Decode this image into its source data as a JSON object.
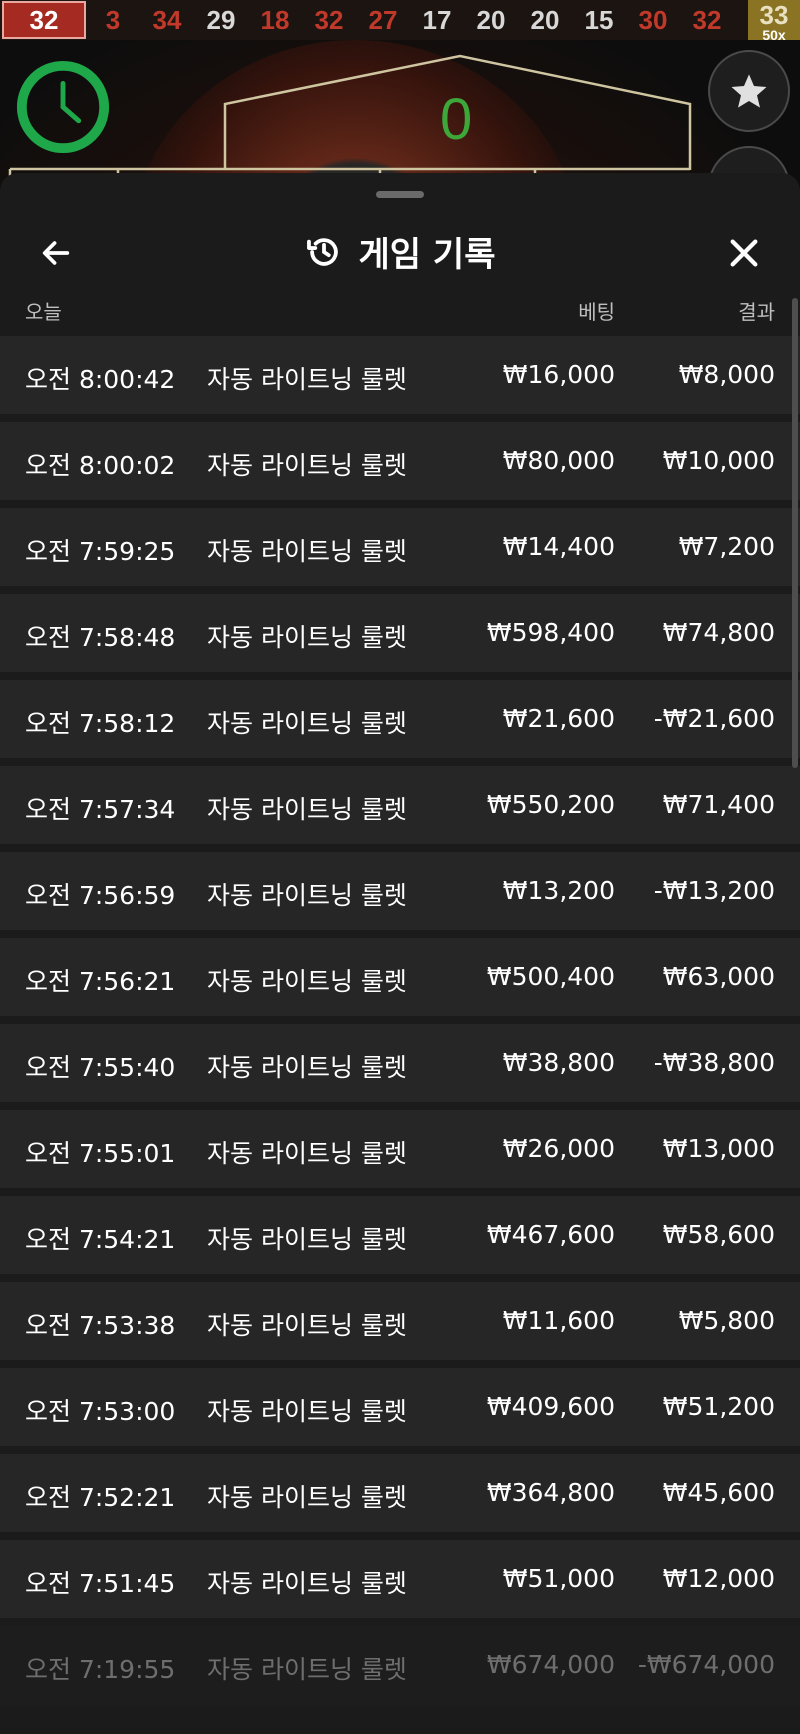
{
  "results_strip": {
    "first": "32",
    "numbers": [
      {
        "value": "3",
        "color": "red"
      },
      {
        "value": "34",
        "color": "red"
      },
      {
        "value": "29",
        "color": "black"
      },
      {
        "value": "18",
        "color": "red"
      },
      {
        "value": "32",
        "color": "red"
      },
      {
        "value": "27",
        "color": "red"
      },
      {
        "value": "17",
        "color": "black"
      },
      {
        "value": "20",
        "color": "black"
      },
      {
        "value": "20",
        "color": "black"
      },
      {
        "value": "15",
        "color": "black"
      },
      {
        "value": "30",
        "color": "red"
      },
      {
        "value": "32",
        "color": "red"
      }
    ],
    "last": "33",
    "last_multiplier": "50x"
  },
  "game": {
    "zero_label": "0"
  },
  "header": {
    "title": "게임 기록",
    "back_icon": "arrow-left-icon",
    "history_icon": "history-icon",
    "close_icon": "close-icon"
  },
  "columns": {
    "date": "오늘",
    "bet": "베팅",
    "result": "결과"
  },
  "rows": [
    {
      "time": "오전 8:00:42",
      "game": "자동 라이트닝 룰렛",
      "bet": "₩16,000",
      "result": "₩8,000"
    },
    {
      "time": "오전 8:00:02",
      "game": "자동 라이트닝 룰렛",
      "bet": "₩80,000",
      "result": "₩10,000"
    },
    {
      "time": "오전 7:59:25",
      "game": "자동 라이트닝 룰렛",
      "bet": "₩14,400",
      "result": "₩7,200"
    },
    {
      "time": "오전 7:58:48",
      "game": "자동 라이트닝 룰렛",
      "bet": "₩598,400",
      "result": "₩74,800"
    },
    {
      "time": "오전 7:58:12",
      "game": "자동 라이트닝 룰렛",
      "bet": "₩21,600",
      "result": "-₩21,600"
    },
    {
      "time": "오전 7:57:34",
      "game": "자동 라이트닝 룰렛",
      "bet": "₩550,200",
      "result": "₩71,400"
    },
    {
      "time": "오전 7:56:59",
      "game": "자동 라이트닝 룰렛",
      "bet": "₩13,200",
      "result": "-₩13,200"
    },
    {
      "time": "오전 7:56:21",
      "game": "자동 라이트닝 룰렛",
      "bet": "₩500,400",
      "result": "₩63,000"
    },
    {
      "time": "오전 7:55:40",
      "game": "자동 라이트닝 룰렛",
      "bet": "₩38,800",
      "result": "-₩38,800"
    },
    {
      "time": "오전 7:55:01",
      "game": "자동 라이트닝 룰렛",
      "bet": "₩26,000",
      "result": "₩13,000"
    },
    {
      "time": "오전 7:54:21",
      "game": "자동 라이트닝 룰렛",
      "bet": "₩467,600",
      "result": "₩58,600"
    },
    {
      "time": "오전 7:53:38",
      "game": "자동 라이트닝 룰렛",
      "bet": "₩11,600",
      "result": "₩5,800"
    },
    {
      "time": "오전 7:53:00",
      "game": "자동 라이트닝 룰렛",
      "bet": "₩409,600",
      "result": "₩51,200"
    },
    {
      "time": "오전 7:52:21",
      "game": "자동 라이트닝 룰렛",
      "bet": "₩364,800",
      "result": "₩45,600"
    },
    {
      "time": "오전 7:51:45",
      "game": "자동 라이트닝 룰렛",
      "bet": "₩51,000",
      "result": "₩12,000"
    },
    {
      "time": "오전 7:19:55",
      "game": "자동 라이트닝 룰렛",
      "bet": "₩674,000",
      "result": "-₩674,000"
    }
  ],
  "colors": {
    "timer_green": "#1fa84a",
    "red_number": "#c0392b",
    "sheet_bg": "#1b1b1b",
    "row_bg": "#262626"
  }
}
